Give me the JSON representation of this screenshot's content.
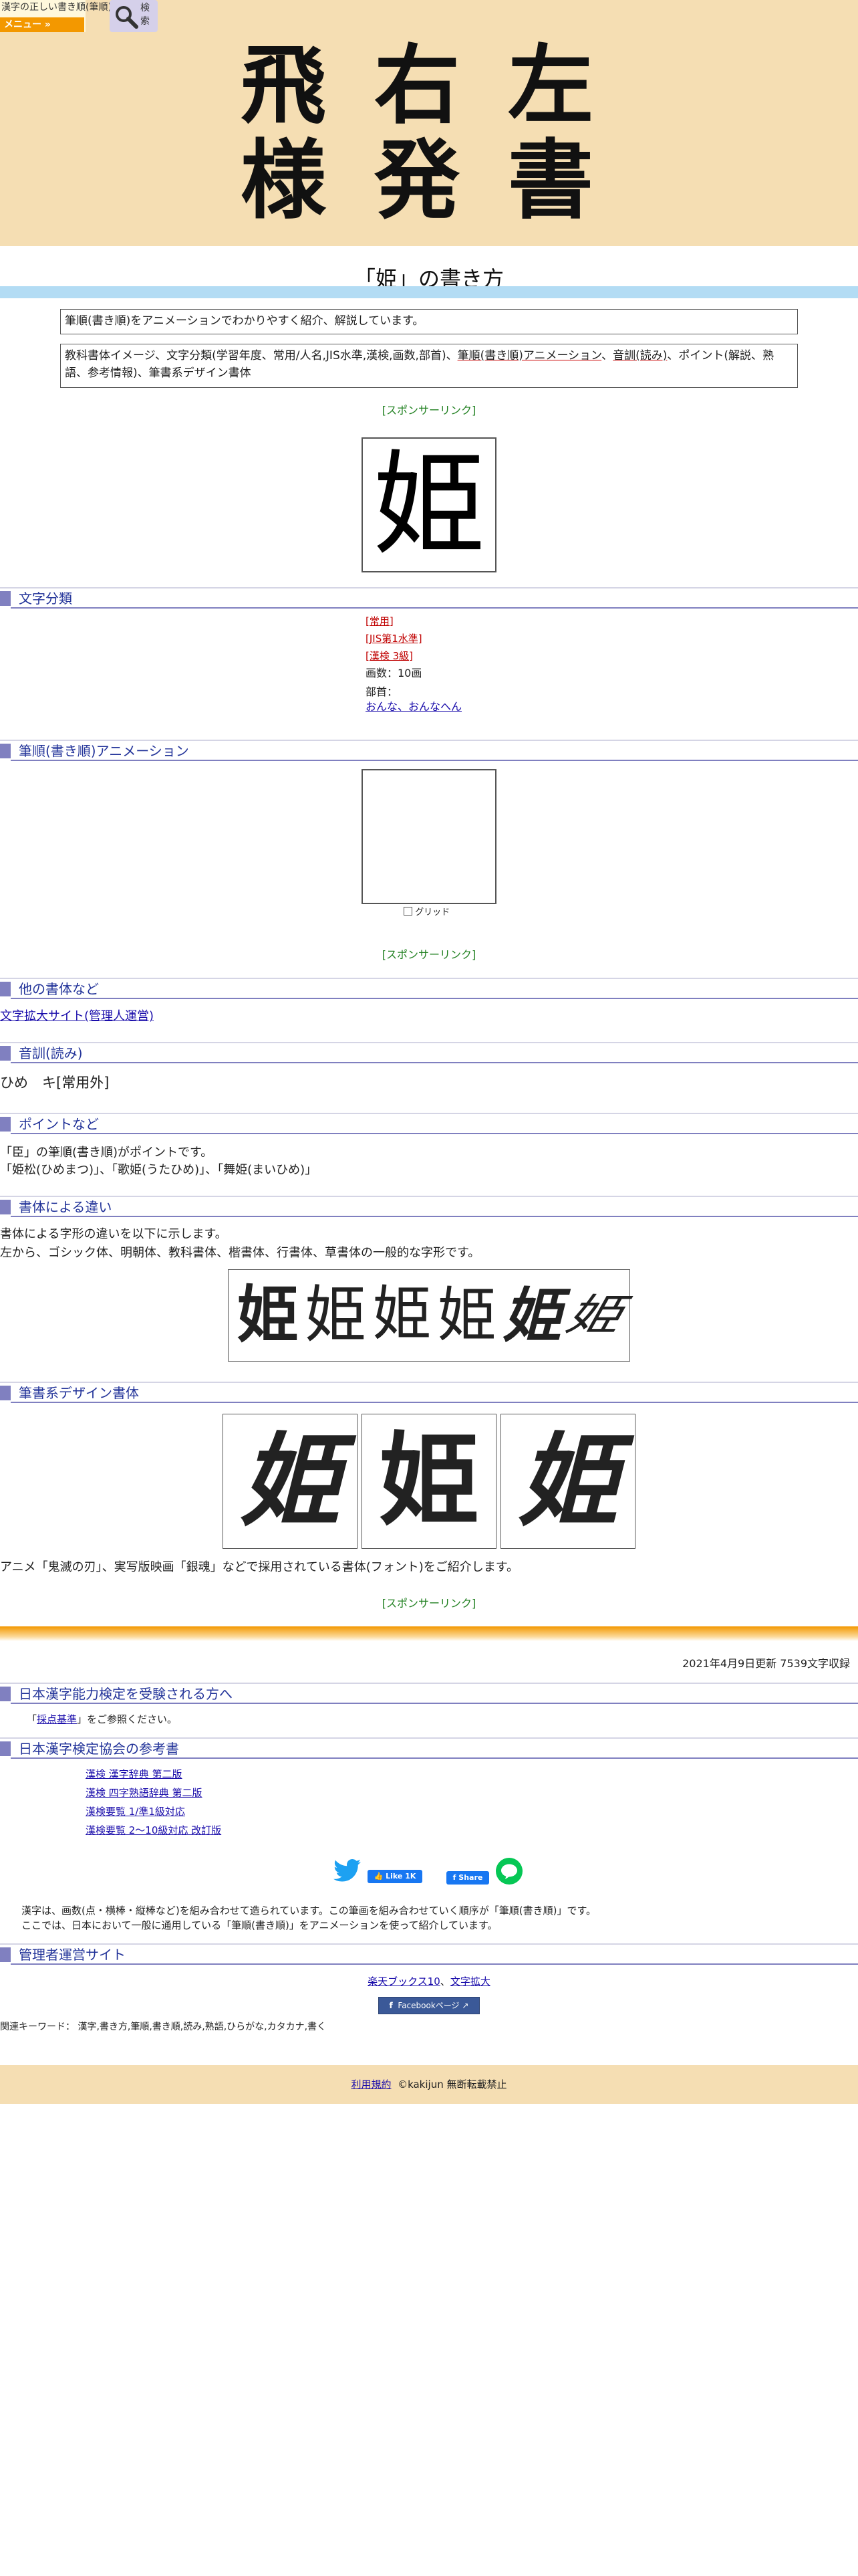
{
  "header": {
    "logo_text": "漢字の正しい書き順(筆順)",
    "menu_label": "メニュー »",
    "search_label": "検索",
    "title_chars": [
      "飛",
      "右",
      "左",
      "様",
      "発",
      "書"
    ]
  },
  "page_title": "「姫」の書き方",
  "intro": {
    "summary": "筆順(書き順)をアニメーションでわかりやすく紹介、解説しています。",
    "contents_pre": "教科書体イメージ、文字分類(学習年度、常用/人名,JIS水準,漢検,画数,部首)、",
    "contents_link1": "筆順(書き順)アニメーション",
    "contents_sep": "、",
    "contents_link2": "音訓(読み)",
    "contents_post": "、ポイント(解説、熟語、参考情報)、筆書系デザイン書体"
  },
  "sponsor_label": "[スポンサーリンク]",
  "kanji": "姫",
  "sections": {
    "classification": "文字分類",
    "animation": "筆順(書き順)アニメーション",
    "other_fonts": "他の書体など",
    "reading": "音訓(読み)",
    "points": "ポイントなど",
    "styles": "書体による違い",
    "brush": "筆書系デザイン書体",
    "kentei": "日本漢字能力検定を受験される方へ",
    "references": "日本漢字検定協会の参考書",
    "admin": "管理者運営サイト"
  },
  "classification": {
    "tag1": "[常用]",
    "tag2": "[JIS第1水準]",
    "tag3": "[漢検 3級]",
    "strokes": "画数：10画",
    "radical_label": "部首：",
    "radical": "おんな、おんなへん"
  },
  "animation": {
    "grid_label": "グリッド"
  },
  "other_fonts_link": "文字拡大サイト(管理人運営)",
  "reading_text": "ひめ　キ[常用外]",
  "points": {
    "line1": "「臣」の筆順(書き順)がポイントです。",
    "line2": "「姫松(ひめまつ)」、「歌姫(うたひめ)」、「舞姫(まいひめ)」"
  },
  "styles": {
    "line1": "書体による字形の違いを以下に示します。",
    "line2": "左から、ゴシック体、明朝体、教科書体、楷書体、行書体、草書体の一般的な字形です。"
  },
  "brush_caption": "アニメ「鬼滅の刃」、実写版映画「銀魂」などで採用されている書体(フォント)をご紹介します。",
  "update_text": "2021年4月9日更新 7539文字収録",
  "kentei": {
    "open": "「",
    "link": "採点基準",
    "close": "」をご参照ください。"
  },
  "references": [
    "漢検 漢字辞典 第二版",
    "漢検 四字熟語辞典 第二版",
    "漢検要覧 1/準1級対応",
    "漢検要覧 2～10級対応 改訂版"
  ],
  "social": {
    "like": "Like 1K",
    "share": "Share"
  },
  "about": {
    "line1": "漢字は、画数(点・横棒・縦棒など)を組み合わせて造られています。この筆画を組み合わせていく順序が「筆順(書き順)」です。",
    "line2": "ここでは、日本において一般に通用している「筆順(書き順)」をアニメーションを使って紹介しています。"
  },
  "admin": {
    "link1": "楽天ブックス10",
    "sep": "、",
    "link2": "文字拡大",
    "facebook": "Facebookページ"
  },
  "keywords": "関連キーワード： 漢字,書き方,筆順,書き順,読み,熟語,ひらがな,カタカナ,書く",
  "footer": {
    "terms": "利用規約",
    "copyright": "©kakijun 無断転載禁止"
  },
  "colors": {
    "header_bg": "#f5deb3",
    "menu_orange": "#f39800",
    "section_accent": "#8080c0",
    "section_title": "#223399",
    "sponsor_green": "#208020",
    "tag_red": "#c00000"
  }
}
